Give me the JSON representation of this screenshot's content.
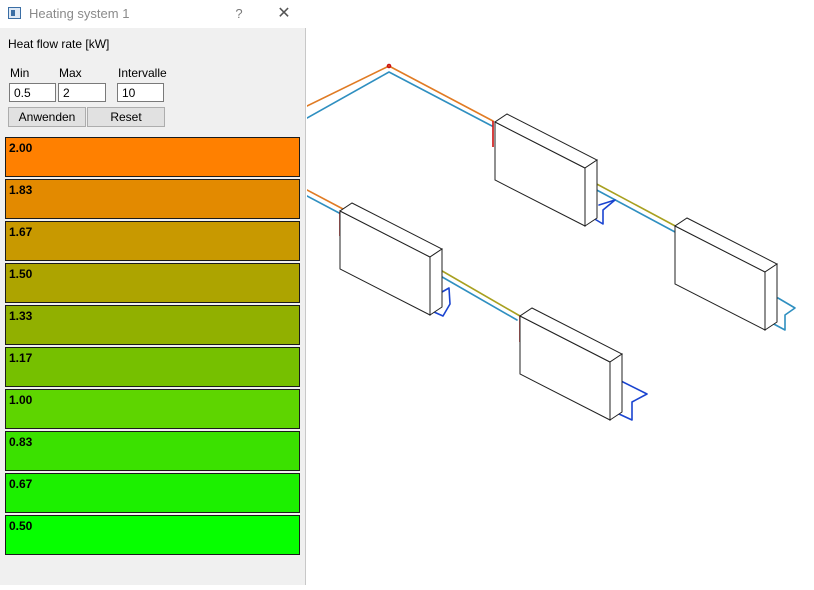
{
  "window": {
    "title": "Heating system 1",
    "help_label": "?",
    "close_label": "✕",
    "icon": "app-window-icon"
  },
  "panel": {
    "section_title": "Heat flow rate [kW]",
    "min_label": "Min",
    "max_label": "Max",
    "intervals_label": "Intervalle",
    "min_value": "0.5",
    "max_value": "2",
    "intervals_value": "10",
    "apply_label": "Anwenden",
    "reset_label": "Reset"
  },
  "legend": [
    {
      "label": "2.00",
      "color": "#ff8000"
    },
    {
      "label": "1.83",
      "color": "#e38a00"
    },
    {
      "label": "1.67",
      "color": "#c89900"
    },
    {
      "label": "1.50",
      "color": "#ada400"
    },
    {
      "label": "1.33",
      "color": "#91b000"
    },
    {
      "label": "1.17",
      "color": "#76c000"
    },
    {
      "label": "1.00",
      "color": "#5ed500"
    },
    {
      "label": "0.83",
      "color": "#3be100"
    },
    {
      "label": "0.67",
      "color": "#1cf000"
    },
    {
      "label": "0.50",
      "color": "#06ff00"
    }
  ],
  "colors": {
    "supply_pipe": "#e07b24",
    "supply_pipe_2": "#a8a020",
    "return_pipe": "#2f8fc0",
    "return_pipe_2": "#1a44d0",
    "valve": "#cc1010",
    "radiator_fill": "#ffffff",
    "radiator_stroke": "#222222"
  }
}
